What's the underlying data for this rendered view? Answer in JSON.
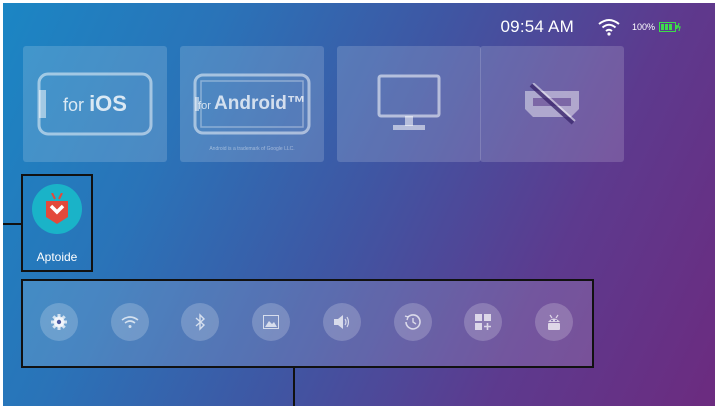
{
  "status": {
    "time": "09:54 AM",
    "battery_percent": "100%",
    "battery_level": 1.0,
    "charging": true,
    "wifi_icon": "wifi-icon"
  },
  "tiles": [
    {
      "id": "ios",
      "prefix": "for",
      "name": "iOS",
      "icon": "iphone-icon"
    },
    {
      "id": "android",
      "prefix": "for",
      "name": "Android™",
      "note": "Android is a trademark of Google LLC.",
      "icon": "android-phone-icon"
    },
    {
      "id": "monitor",
      "icon": "monitor-icon"
    },
    {
      "id": "hdmi-off",
      "icon": "hdmi-disconnected-icon"
    }
  ],
  "apps": [
    {
      "label": "Aptoide",
      "icon": "aptoide-icon",
      "accent": "#1ab3c8"
    }
  ],
  "dock": [
    {
      "icon": "gear-icon"
    },
    {
      "icon": "wifi-icon"
    },
    {
      "icon": "bluetooth-icon"
    },
    {
      "icon": "image-icon"
    },
    {
      "icon": "volume-icon"
    },
    {
      "icon": "history-icon"
    },
    {
      "icon": "apps-add-icon"
    },
    {
      "icon": "android-icon"
    }
  ],
  "colors": {
    "gradient_start": "#1b86c4",
    "gradient_end": "#6c2b7f",
    "battery_green": "#3ddc4a"
  }
}
